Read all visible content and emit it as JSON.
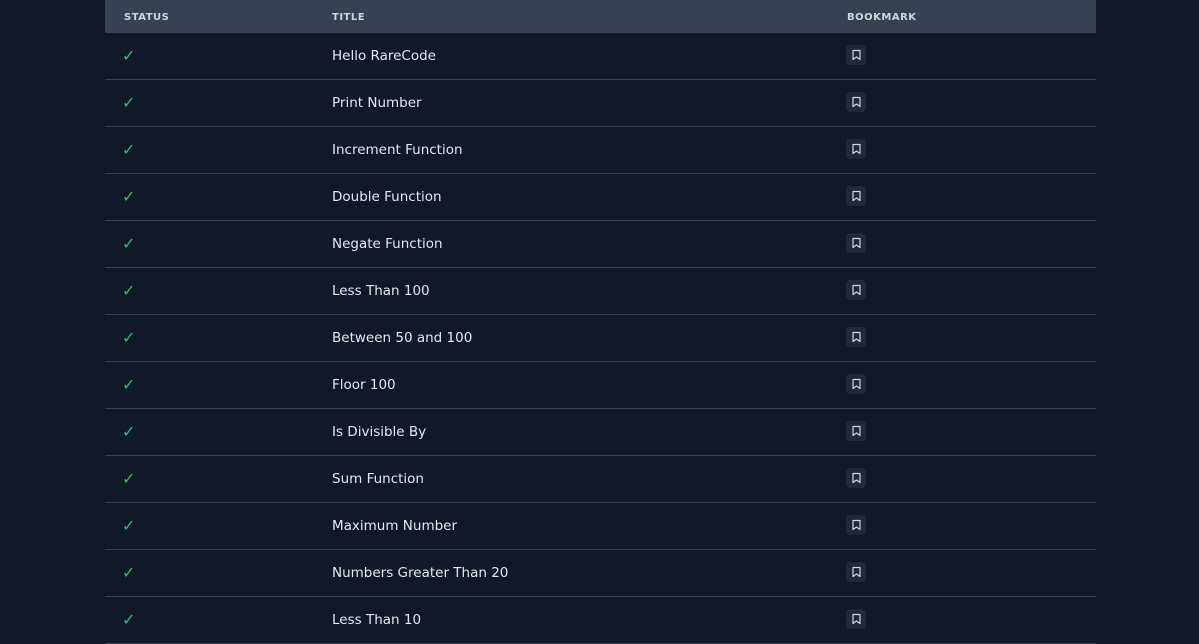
{
  "table": {
    "headers": {
      "status": "STATUS",
      "title": "TITLE",
      "bookmark": "BOOKMARK"
    },
    "rows": [
      {
        "status": "✓",
        "title": "Hello RareCode"
      },
      {
        "status": "✓",
        "title": "Print Number"
      },
      {
        "status": "✓",
        "title": "Increment Function"
      },
      {
        "status": "✓",
        "title": "Double Function"
      },
      {
        "status": "✓",
        "title": "Negate Function"
      },
      {
        "status": "✓",
        "title": "Less Than 100"
      },
      {
        "status": "✓",
        "title": "Between 50 and 100"
      },
      {
        "status": "✓",
        "title": "Floor 100"
      },
      {
        "status": "✓",
        "title": "Is Divisible By"
      },
      {
        "status": "✓",
        "title": "Sum Function"
      },
      {
        "status": "✓",
        "title": "Maximum Number"
      },
      {
        "status": "✓",
        "title": "Numbers Greater Than 20"
      },
      {
        "status": "✓",
        "title": "Less Than 10"
      }
    ]
  },
  "icons": {
    "status": "check-icon",
    "bookmark": "bookmark-icon"
  },
  "colors": {
    "background": "#111827",
    "header": "#374151",
    "check": "#22c55e",
    "text": "#e5e7eb"
  }
}
